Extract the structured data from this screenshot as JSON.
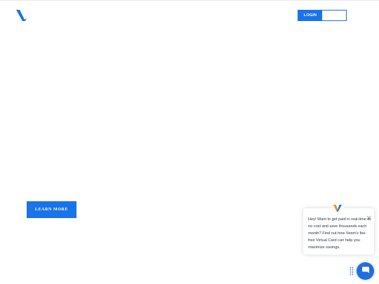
{
  "header": {
    "logo_icon": "veem-v-logo-icon",
    "login_label": "LOGIN"
  },
  "hero": {
    "learn_more_label": "LEARN MORE"
  },
  "chat": {
    "avatar_icon": "veem-v-logo-icon",
    "close_icon": "close-icon",
    "message": "Hey! Want to get paid in real-time at no cost and save thousands each month? Find out how Veem's fee-free Virtual Card can help you maximize savings.",
    "launcher_icon": "chat-bubble-icon",
    "handle_icon": "drag-handle-icon"
  },
  "colors": {
    "brand_blue": "#1a73e8",
    "brand_orange": "#f28a1e",
    "background": "#ffffff"
  }
}
